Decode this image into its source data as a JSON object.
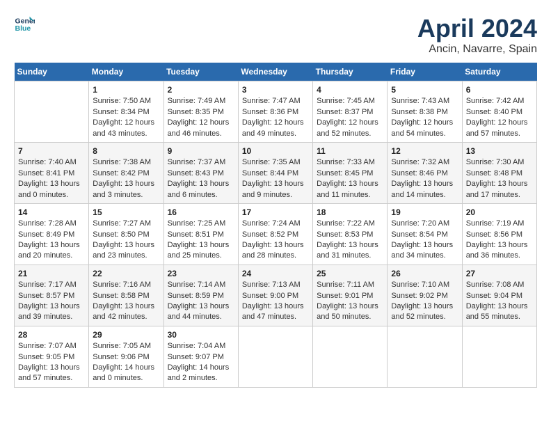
{
  "header": {
    "logo_line1": "General",
    "logo_line2": "Blue",
    "month_title": "April 2024",
    "location": "Ancin, Navarre, Spain"
  },
  "weekdays": [
    "Sunday",
    "Monday",
    "Tuesday",
    "Wednesday",
    "Thursday",
    "Friday",
    "Saturday"
  ],
  "weeks": [
    [
      {
        "day": "",
        "sunrise": "",
        "sunset": "",
        "daylight": ""
      },
      {
        "day": "1",
        "sunrise": "Sunrise: 7:50 AM",
        "sunset": "Sunset: 8:34 PM",
        "daylight": "Daylight: 12 hours and 43 minutes."
      },
      {
        "day": "2",
        "sunrise": "Sunrise: 7:49 AM",
        "sunset": "Sunset: 8:35 PM",
        "daylight": "Daylight: 12 hours and 46 minutes."
      },
      {
        "day": "3",
        "sunrise": "Sunrise: 7:47 AM",
        "sunset": "Sunset: 8:36 PM",
        "daylight": "Daylight: 12 hours and 49 minutes."
      },
      {
        "day": "4",
        "sunrise": "Sunrise: 7:45 AM",
        "sunset": "Sunset: 8:37 PM",
        "daylight": "Daylight: 12 hours and 52 minutes."
      },
      {
        "day": "5",
        "sunrise": "Sunrise: 7:43 AM",
        "sunset": "Sunset: 8:38 PM",
        "daylight": "Daylight: 12 hours and 54 minutes."
      },
      {
        "day": "6",
        "sunrise": "Sunrise: 7:42 AM",
        "sunset": "Sunset: 8:40 PM",
        "daylight": "Daylight: 12 hours and 57 minutes."
      }
    ],
    [
      {
        "day": "7",
        "sunrise": "Sunrise: 7:40 AM",
        "sunset": "Sunset: 8:41 PM",
        "daylight": "Daylight: 13 hours and 0 minutes."
      },
      {
        "day": "8",
        "sunrise": "Sunrise: 7:38 AM",
        "sunset": "Sunset: 8:42 PM",
        "daylight": "Daylight: 13 hours and 3 minutes."
      },
      {
        "day": "9",
        "sunrise": "Sunrise: 7:37 AM",
        "sunset": "Sunset: 8:43 PM",
        "daylight": "Daylight: 13 hours and 6 minutes."
      },
      {
        "day": "10",
        "sunrise": "Sunrise: 7:35 AM",
        "sunset": "Sunset: 8:44 PM",
        "daylight": "Daylight: 13 hours and 9 minutes."
      },
      {
        "day": "11",
        "sunrise": "Sunrise: 7:33 AM",
        "sunset": "Sunset: 8:45 PM",
        "daylight": "Daylight: 13 hours and 11 minutes."
      },
      {
        "day": "12",
        "sunrise": "Sunrise: 7:32 AM",
        "sunset": "Sunset: 8:46 PM",
        "daylight": "Daylight: 13 hours and 14 minutes."
      },
      {
        "day": "13",
        "sunrise": "Sunrise: 7:30 AM",
        "sunset": "Sunset: 8:48 PM",
        "daylight": "Daylight: 13 hours and 17 minutes."
      }
    ],
    [
      {
        "day": "14",
        "sunrise": "Sunrise: 7:28 AM",
        "sunset": "Sunset: 8:49 PM",
        "daylight": "Daylight: 13 hours and 20 minutes."
      },
      {
        "day": "15",
        "sunrise": "Sunrise: 7:27 AM",
        "sunset": "Sunset: 8:50 PM",
        "daylight": "Daylight: 13 hours and 23 minutes."
      },
      {
        "day": "16",
        "sunrise": "Sunrise: 7:25 AM",
        "sunset": "Sunset: 8:51 PM",
        "daylight": "Daylight: 13 hours and 25 minutes."
      },
      {
        "day": "17",
        "sunrise": "Sunrise: 7:24 AM",
        "sunset": "Sunset: 8:52 PM",
        "daylight": "Daylight: 13 hours and 28 minutes."
      },
      {
        "day": "18",
        "sunrise": "Sunrise: 7:22 AM",
        "sunset": "Sunset: 8:53 PM",
        "daylight": "Daylight: 13 hours and 31 minutes."
      },
      {
        "day": "19",
        "sunrise": "Sunrise: 7:20 AM",
        "sunset": "Sunset: 8:54 PM",
        "daylight": "Daylight: 13 hours and 34 minutes."
      },
      {
        "day": "20",
        "sunrise": "Sunrise: 7:19 AM",
        "sunset": "Sunset: 8:56 PM",
        "daylight": "Daylight: 13 hours and 36 minutes."
      }
    ],
    [
      {
        "day": "21",
        "sunrise": "Sunrise: 7:17 AM",
        "sunset": "Sunset: 8:57 PM",
        "daylight": "Daylight: 13 hours and 39 minutes."
      },
      {
        "day": "22",
        "sunrise": "Sunrise: 7:16 AM",
        "sunset": "Sunset: 8:58 PM",
        "daylight": "Daylight: 13 hours and 42 minutes."
      },
      {
        "day": "23",
        "sunrise": "Sunrise: 7:14 AM",
        "sunset": "Sunset: 8:59 PM",
        "daylight": "Daylight: 13 hours and 44 minutes."
      },
      {
        "day": "24",
        "sunrise": "Sunrise: 7:13 AM",
        "sunset": "Sunset: 9:00 PM",
        "daylight": "Daylight: 13 hours and 47 minutes."
      },
      {
        "day": "25",
        "sunrise": "Sunrise: 7:11 AM",
        "sunset": "Sunset: 9:01 PM",
        "daylight": "Daylight: 13 hours and 50 minutes."
      },
      {
        "day": "26",
        "sunrise": "Sunrise: 7:10 AM",
        "sunset": "Sunset: 9:02 PM",
        "daylight": "Daylight: 13 hours and 52 minutes."
      },
      {
        "day": "27",
        "sunrise": "Sunrise: 7:08 AM",
        "sunset": "Sunset: 9:04 PM",
        "daylight": "Daylight: 13 hours and 55 minutes."
      }
    ],
    [
      {
        "day": "28",
        "sunrise": "Sunrise: 7:07 AM",
        "sunset": "Sunset: 9:05 PM",
        "daylight": "Daylight: 13 hours and 57 minutes."
      },
      {
        "day": "29",
        "sunrise": "Sunrise: 7:05 AM",
        "sunset": "Sunset: 9:06 PM",
        "daylight": "Daylight: 14 hours and 0 minutes."
      },
      {
        "day": "30",
        "sunrise": "Sunrise: 7:04 AM",
        "sunset": "Sunset: 9:07 PM",
        "daylight": "Daylight: 14 hours and 2 minutes."
      },
      {
        "day": "",
        "sunrise": "",
        "sunset": "",
        "daylight": ""
      },
      {
        "day": "",
        "sunrise": "",
        "sunset": "",
        "daylight": ""
      },
      {
        "day": "",
        "sunrise": "",
        "sunset": "",
        "daylight": ""
      },
      {
        "day": "",
        "sunrise": "",
        "sunset": "",
        "daylight": ""
      }
    ]
  ]
}
